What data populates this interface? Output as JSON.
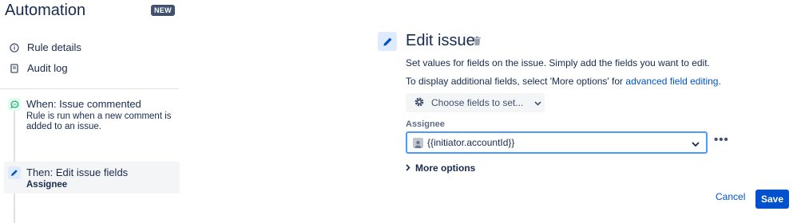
{
  "header": {
    "title": "Automation",
    "badge": "NEW"
  },
  "sidebar": {
    "nav": [
      {
        "label": "Rule details",
        "icon": "info-icon"
      },
      {
        "label": "Audit log",
        "icon": "document-icon"
      }
    ],
    "trigger": {
      "title": "When: Issue commented",
      "description": "Rule is run when a new comment is added to an issue.",
      "icon": "comment-icon",
      "color": "#36b37e"
    },
    "action": {
      "title": "Then: Edit issue fields",
      "subtitle": "Assignee",
      "icon": "pencil-icon",
      "color": "#0052cc"
    }
  },
  "main": {
    "title": "Edit issue",
    "description": "Set values for fields on the issue. Simply add the fields you want to edit.",
    "additional_prefix": "To display additional fields, select 'More options' for ",
    "additional_link": "advanced field editing",
    "additional_suffix": ".",
    "choose_fields_label": "Choose fields to set...",
    "field": {
      "label": "Assignee",
      "value": "{{initiator.accountId}}"
    },
    "more_options_label": "More options",
    "cancel_label": "Cancel",
    "save_label": "Save"
  },
  "colors": {
    "accent": "#0052cc",
    "focus": "#4c9aff",
    "text": "#172b4d"
  }
}
